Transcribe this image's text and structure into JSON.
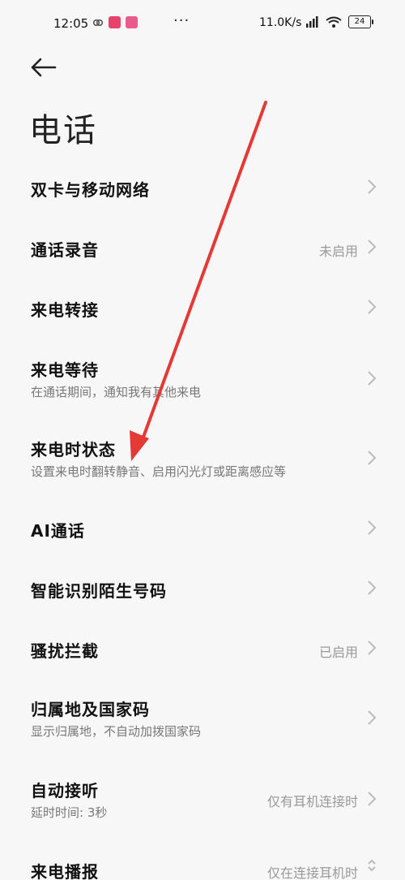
{
  "status_bar": {
    "time": "12:05",
    "dots": "···",
    "net_speed": "11.0K/s",
    "battery": "24",
    "app_icon_colors": [
      "#e6426b",
      "#e85b8a"
    ]
  },
  "header": {
    "back_icon": "arrow-left-icon",
    "title": "电话"
  },
  "items": [
    {
      "title": "双卡与移动网络",
      "subtitle": "",
      "value": ""
    },
    {
      "title": "通话录音",
      "subtitle": "",
      "value": "未启用"
    },
    {
      "title": "来电转接",
      "subtitle": "",
      "value": ""
    },
    {
      "title": "来电等待",
      "subtitle": "在通话期间，通知我有其他来电",
      "value": ""
    },
    {
      "title": "来电时状态",
      "subtitle": "设置来电时翻转静音、启用闪光灯或距离感应等",
      "value": ""
    },
    {
      "title": "AI通话",
      "subtitle": "",
      "value": ""
    },
    {
      "title": "智能识别陌生号码",
      "subtitle": "",
      "value": ""
    },
    {
      "title": "骚扰拦截",
      "subtitle": "",
      "value": "已启用"
    },
    {
      "title": "归属地及国家码",
      "subtitle": "显示归属地，不自动加拨国家码",
      "value": ""
    },
    {
      "title": "自动接听",
      "subtitle": "延时时间: 3秒",
      "value": "仅有耳机连接时"
    },
    {
      "title": "来电播报",
      "subtitle": "",
      "value": "仅在连接耳机时"
    }
  ],
  "annotation": {
    "color": "#e53935"
  }
}
